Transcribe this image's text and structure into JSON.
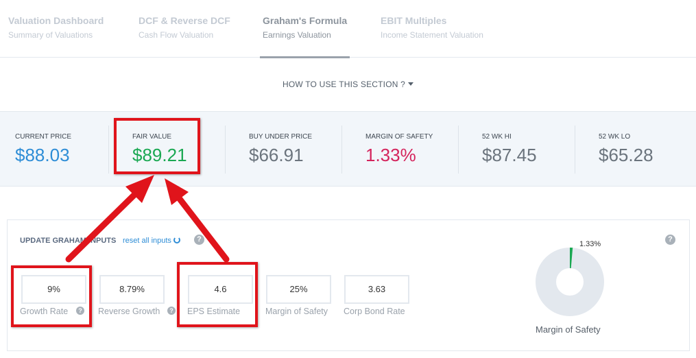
{
  "tabs": [
    {
      "title": "Valuation Dashboard",
      "subtitle": "Summary of Valuations",
      "active": false
    },
    {
      "title": "DCF & Reverse DCF",
      "subtitle": "Cash Flow Valuation",
      "active": false
    },
    {
      "title": "Graham's Formula",
      "subtitle": "Earnings Valuation",
      "active": true
    },
    {
      "title": "EBIT Multiples",
      "subtitle": "Income Statement Valuation",
      "active": false
    }
  ],
  "howto": {
    "label": "HOW TO USE THIS SECTION ?"
  },
  "metrics": [
    {
      "label": "CURRENT PRICE",
      "value": "$88.03",
      "color": "#2e8dd6"
    },
    {
      "label": "FAIR VALUE",
      "value": "$89.21",
      "color": "#1aa852"
    },
    {
      "label": "BUY UNDER PRICE",
      "value": "$66.91",
      "color": "#6b747d"
    },
    {
      "label": "MARGIN OF SAFETY",
      "value": "1.33%",
      "color": "#d4245c"
    },
    {
      "label": "52 WK HI",
      "value": "$87.45",
      "color": "#6b747d"
    },
    {
      "label": "52 WK LO",
      "value": "$65.28",
      "color": "#6b747d"
    }
  ],
  "panel": {
    "title": "UPDATE GRAHAM INPUTS",
    "reset_label": "reset all inputs",
    "help": "?",
    "inputs": [
      {
        "value": "9%",
        "label": "Growth Rate",
        "help": true
      },
      {
        "value": "8.79%",
        "label": "Reverse Growth",
        "help": true
      },
      {
        "value": "4.6",
        "label": "EPS Estimate",
        "help": false
      },
      {
        "value": "25%",
        "label": "Margin of Safety",
        "help": false
      },
      {
        "value": "3.63",
        "label": "Corp Bond Rate",
        "help": false
      }
    ],
    "donut": {
      "percent": 1.33,
      "label": "1.33%",
      "caption": "Margin of Safety",
      "fill_color": "#1aa852",
      "track_color": "#e3e8ee"
    }
  },
  "colors": {
    "annotation_red": "#e0141b"
  }
}
